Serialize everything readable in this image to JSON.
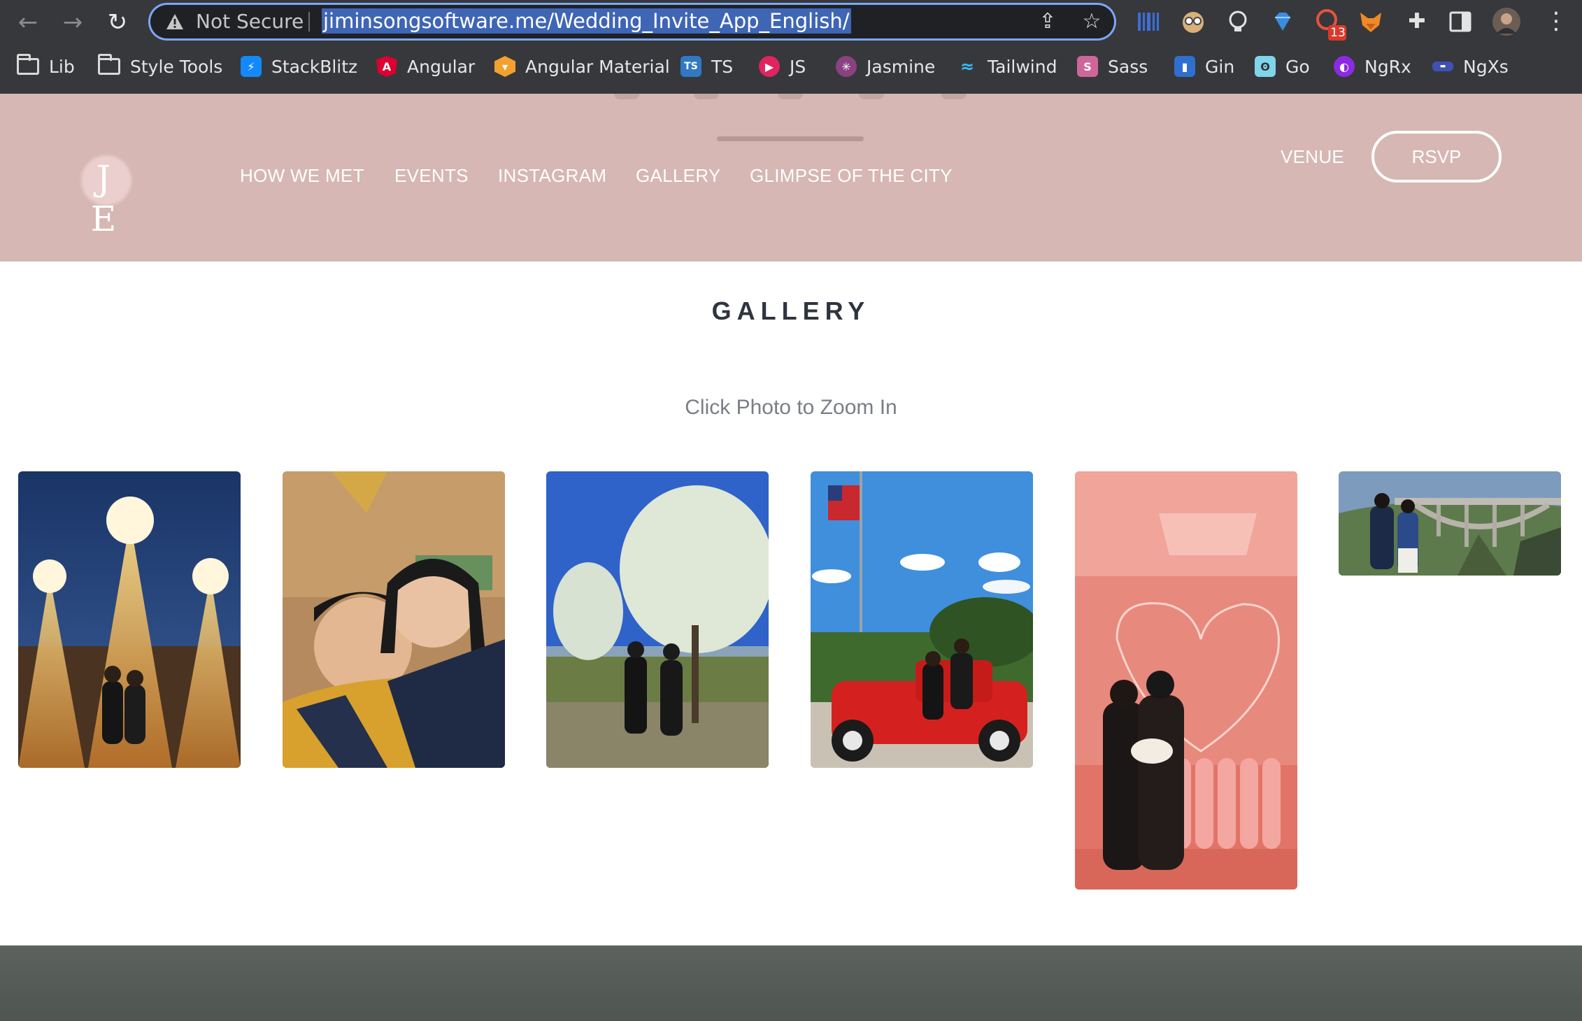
{
  "browser": {
    "security_label": "Not Secure",
    "url": "jiminsongsoftware.me/Wedding_Invite_App_English/",
    "extension_badge": "13",
    "bookmarks": [
      {
        "label": "Lib",
        "icon": "folder-icon"
      },
      {
        "label": "Style Tools",
        "icon": "folder-icon"
      },
      {
        "label": "StackBlitz",
        "icon": "stackblitz-icon"
      },
      {
        "label": "Angular",
        "icon": "angular-icon"
      },
      {
        "label": "Angular Material",
        "icon": "angular-material-icon"
      },
      {
        "label": "TS",
        "icon": "typescript-icon"
      },
      {
        "label": "JS",
        "icon": "javascript-icon"
      },
      {
        "label": "Jasmine",
        "icon": "jasmine-icon"
      },
      {
        "label": "Tailwind",
        "icon": "tailwind-icon"
      },
      {
        "label": "Sass",
        "icon": "sass-icon"
      },
      {
        "label": "Gin",
        "icon": "gin-icon"
      },
      {
        "label": "Go",
        "icon": "go-icon"
      },
      {
        "label": "NgRx",
        "icon": "ngrx-icon"
      },
      {
        "label": "NgXs",
        "icon": "ngxs-icon"
      }
    ]
  },
  "site": {
    "logo_text": "J E",
    "nav": [
      {
        "label": "HOW WE MET"
      },
      {
        "label": "EVENTS"
      },
      {
        "label": "INSTAGRAM"
      },
      {
        "label": "GALLERY"
      },
      {
        "label": "GLIMPSE OF THE CITY"
      }
    ],
    "venue_label": "VENUE",
    "rsvp_label": "RSVP",
    "header_color": "#d6b7b3"
  },
  "gallery": {
    "title": "GALLERY",
    "subtitle": "Click Photo to Zoom In",
    "photos": [
      {
        "scene": "couple-christmas-light-trees-night"
      },
      {
        "scene": "couple-selfie-yellow-sweaters"
      },
      {
        "scene": "couple-under-blossom-tree"
      },
      {
        "scene": "couple-on-red-truck-flag"
      },
      {
        "scene": "couple-mirror-pink-heart-wall"
      },
      {
        "scene": "couple-bridge-coast"
      }
    ]
  }
}
